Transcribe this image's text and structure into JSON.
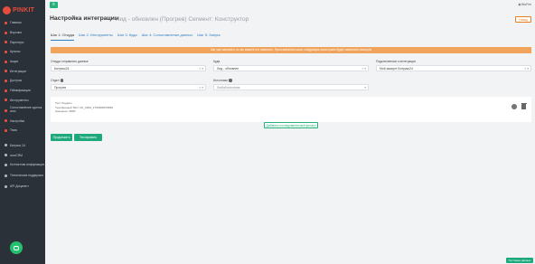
{
  "sidebar": {
    "logo_text": "PINKIT",
    "items": [
      {
        "label": "Главная",
        "icon": "home-icon"
      },
      {
        "label": "Воронки",
        "icon": "funnel-icon"
      },
      {
        "label": "Партнеры",
        "icon": "partners-icon"
      },
      {
        "label": "Купоны",
        "icon": "coupon-icon"
      },
      {
        "label": "Акции",
        "icon": "promo-icon"
      },
      {
        "label": "Интеграции",
        "icon": "integrations-icon"
      },
      {
        "label": "Доступы",
        "icon": "access-icon"
      },
      {
        "label": "Геймификация",
        "icon": "game-icon"
      },
      {
        "label": "Инструменты",
        "icon": "tools-icon"
      },
      {
        "label": "Сопоставление сделок amo",
        "icon": "match-icon"
      },
      {
        "label": "Настройки",
        "icon": "settings-icon"
      },
      {
        "label": "Тема",
        "icon": "theme-icon"
      }
    ],
    "secondary": [
      {
        "label": "Битрикс 24"
      },
      {
        "label": "amoCRM"
      },
      {
        "label": "Контактная информация"
      },
      {
        "label": "Техническая поддержка"
      },
      {
        "label": "API Документ"
      }
    ]
  },
  "topbar": {
    "menu_icon": "menu-icon",
    "user_label": "BioFire"
  },
  "header": {
    "title": "Настройка интеграции",
    "subtitle": "Лид - обновлен (Прогрев) Сегмент: Конструктор",
    "back_label": "Назад"
  },
  "tabs": [
    {
      "label": "Шаг 1: Откуда",
      "active": true
    },
    {
      "label": "Шаг 2: Инструменты",
      "active": false
    },
    {
      "label": "Шаг 3: Куда",
      "active": false
    },
    {
      "label": "Шаг 4: Сопоставление данных",
      "active": false
    },
    {
      "label": "Шаг 5: Запуск",
      "active": false
    }
  ],
  "alert": "Шаг уже заполнен, но вы можете его изменить. При изменении шага, следующие шаги нужно будет заполнить повторно",
  "form": {
    "source_label": "Откуда отправлять данные",
    "source_value": "Битрикс24",
    "where_label": "Куда",
    "where_value": "Лид - обновлен",
    "account_label": "Подключенные к интеграции",
    "account_value": "Мой аккаунт Битрикс24",
    "funnel_label": "Отдел",
    "funnel_value": "Прогрев",
    "src2_label": "Источники",
    "src2_value": "Любой источник"
  },
  "record": {
    "line1": "Тест Лидеры",
    "line2": "Телефонный ТЕст UF_CRM_1705208978065",
    "line3": "Значение: 5800"
  },
  "actions": {
    "add_label": "Добавить последовательный фильтр",
    "save_label": "Продолжить",
    "check_label": "Тестировать",
    "corner_label": "Тестовые данные"
  }
}
